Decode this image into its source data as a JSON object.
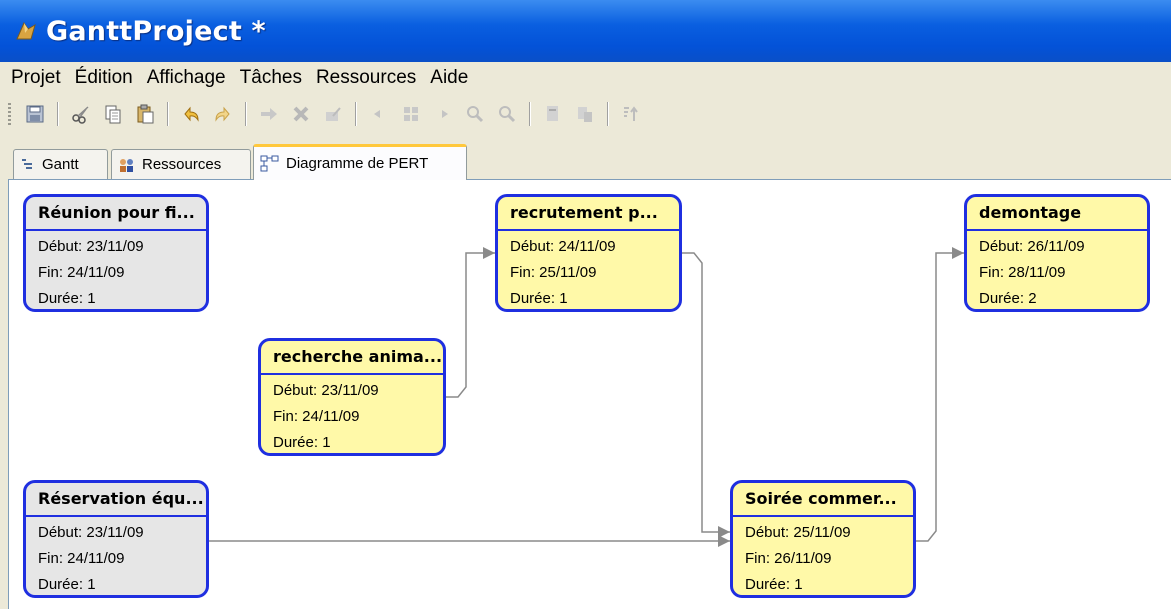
{
  "window": {
    "title": "GanttProject *"
  },
  "menu": [
    "Projet",
    "Édition",
    "Affichage",
    "Tâches",
    "Ressources",
    "Aide"
  ],
  "toolbar": {
    "icons": [
      "save-icon",
      "cut-icon",
      "copy-icon",
      "paste-icon",
      "undo-icon",
      "redo-icon",
      "indent-icon",
      "delete-icon",
      "properties-icon",
      "scroll-left-icon",
      "expand-icon",
      "scroll-right-icon",
      "zoom-in-icon",
      "zoom-out-icon",
      "print-icon",
      "preview-icon",
      "sort-icon"
    ]
  },
  "tabs": [
    {
      "label": "Gantt",
      "active": false
    },
    {
      "label": "Ressources",
      "active": false
    },
    {
      "label": "Diagramme de PERT",
      "active": true
    }
  ],
  "pert": {
    "nodes": [
      {
        "id": "reunion",
        "title": "Réunion pour fi...",
        "start": "Début: 23/11/09",
        "end": "Fin: 24/11/09",
        "duration": "Durée: 1",
        "color": "grey"
      },
      {
        "id": "recherche",
        "title": "recherche anima...",
        "start": "Début: 23/11/09",
        "end": "Fin: 24/11/09",
        "duration": "Durée: 1",
        "color": "yellow"
      },
      {
        "id": "reservation",
        "title": "Réservation équ...",
        "start": "Début: 23/11/09",
        "end": "Fin: 24/11/09",
        "duration": "Durée: 1",
        "color": "grey"
      },
      {
        "id": "recrutement",
        "title": "recrutement p...",
        "start": "Début: 24/11/09",
        "end": "Fin: 25/11/09",
        "duration": "Durée: 1",
        "color": "yellow"
      },
      {
        "id": "soiree",
        "title": "Soirée commer...",
        "start": "Début: 25/11/09",
        "end": "Fin: 26/11/09",
        "duration": "Durée: 1",
        "color": "yellow"
      },
      {
        "id": "demontage",
        "title": "demontage",
        "start": "Début: 26/11/09",
        "end": "Fin: 28/11/09",
        "duration": "Durée: 2",
        "color": "yellow"
      }
    ],
    "links": [
      {
        "from": "recherche",
        "to": "recrutement"
      },
      {
        "from": "recrutement",
        "to": "soiree"
      },
      {
        "from": "reservation",
        "to": "soiree"
      },
      {
        "from": "soiree",
        "to": "demontage"
      }
    ]
  },
  "colors": {
    "node_border": "#1f2fe0",
    "critical_fill": "#fff9a8",
    "normal_fill": "#e6e6e6",
    "titlebar": "#0a5fe0"
  }
}
